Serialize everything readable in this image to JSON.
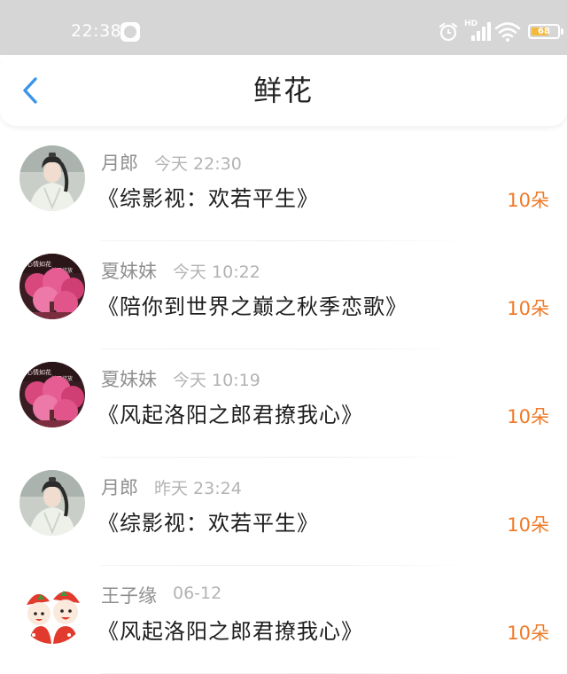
{
  "status_bar": {
    "time": "22:38",
    "app_icon": "wechat-icon",
    "network": "HD",
    "battery": "68",
    "battery_level": 0.68,
    "colors": {
      "background": "#d6d6d6",
      "battery": "#f4b93a"
    }
  },
  "header": {
    "title": "鲜花",
    "back_icon": "chevron-left-icon",
    "back_color": "#3b95e8"
  },
  "accent_color": "#f07a28",
  "gifts": [
    {
      "sender": "月郎",
      "time": "今天 22:30",
      "book": "《综影视：欢若平生》",
      "count": "10朵",
      "avatar": "man-in-white-robe"
    },
    {
      "sender": "夏妹妹",
      "time": "今天 10:22",
      "book": "《陪你到世界之巅之秋季恋歌》",
      "count": "10朵",
      "avatar": "pink-blossom-tree"
    },
    {
      "sender": "夏妹妹",
      "time": "今天 10:19",
      "book": "《风起洛阳之郎君撩我心》",
      "count": "10朵",
      "avatar": "pink-blossom-tree"
    },
    {
      "sender": "月郎",
      "time": "昨天 23:24",
      "book": "《综影视：欢若平生》",
      "count": "10朵",
      "avatar": "man-in-white-robe"
    },
    {
      "sender": "王子缘",
      "time": "06-12",
      "book": "《风起洛阳之郎君撩我心》",
      "count": "10朵",
      "avatar": "cartoon-strawberry-kids"
    }
  ]
}
